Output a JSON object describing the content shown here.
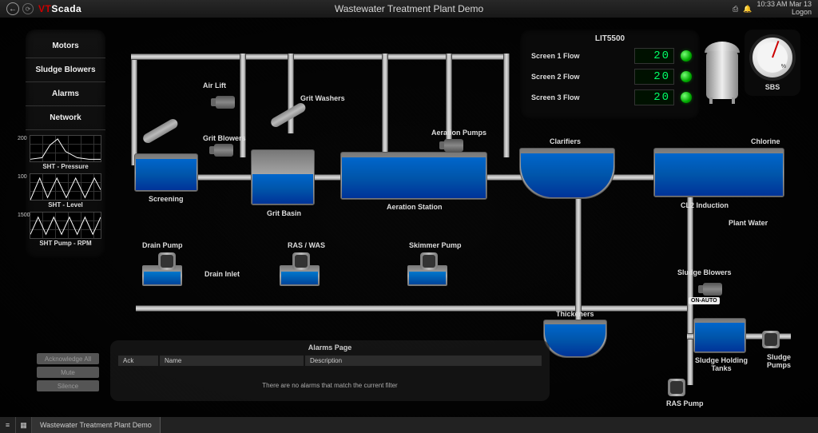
{
  "header": {
    "logo_vt": "VT",
    "logo_rest": "Scada",
    "title": "Wastewater Treatment Plant Demo",
    "time": "10:33 AM  Mar 13",
    "logon": "Logon"
  },
  "sidebar": {
    "items": [
      "Motors",
      "Sludge Blowers",
      "Alarms",
      "Network"
    ],
    "charts": [
      {
        "max": "200",
        "label": "SHT - Pressure"
      },
      {
        "max": "100",
        "label": "SHT - Level"
      },
      {
        "max": "1500",
        "label": "SHT Pump - RPM"
      }
    ]
  },
  "readout": {
    "title": "LIT5500",
    "rows": [
      {
        "label": "Screen 1 Flow",
        "value": "20"
      },
      {
        "label": "Screen 2 Flow",
        "value": "20"
      },
      {
        "label": "Screen 3 Flow",
        "value": "20"
      }
    ]
  },
  "gauge": {
    "label": "SBS",
    "percent": "%"
  },
  "equipment": {
    "air_lift": "Air Lift",
    "grit_washers": "Grit Washers",
    "grit_blowers": "Grit Blowers",
    "screening": "Screening",
    "grit_basin": "Grit Basin",
    "aeration_pumps": "Aeration Pumps",
    "aeration_station": "Aeration Station",
    "clarifiers": "Clarifiers",
    "chlorine": "Chlorine",
    "cl2_induction": "CL2 Induction",
    "plant_water": "Plant Water",
    "drain_pump": "Drain Pump",
    "drain_inlet": "Drain Inlet",
    "ras_was": "RAS / WAS",
    "skimmer_pump": "Skimmer Pump",
    "thickeners": "Thickeners",
    "ras_pump": "RAS Pump",
    "sludge_blowers": "Sludge Blowers",
    "on_auto": "ON-AUTO",
    "sludge_holding_tanks": "Sludge Holding Tanks",
    "sludge_pumps": "Sludge Pumps"
  },
  "alarms": {
    "title": "Alarms Page",
    "cols": [
      "Ack",
      "Name",
      "Description"
    ],
    "empty": "There are no alarms that match the current filter",
    "buttons": [
      "Acknowledge All",
      "Mute",
      "Silence"
    ]
  },
  "footer": {
    "tab": "Wastewater Treatment Plant Demo"
  }
}
